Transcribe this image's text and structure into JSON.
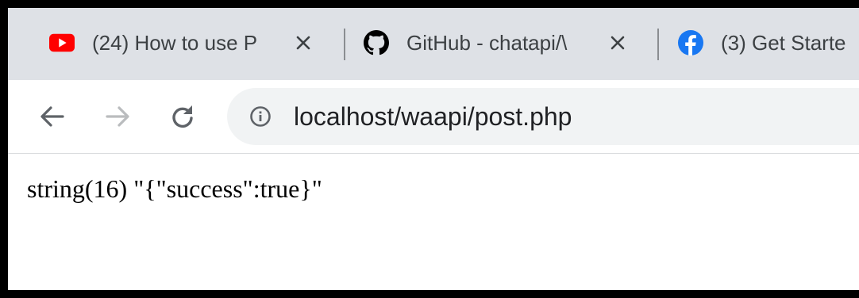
{
  "tabs": [
    {
      "title": "(24) How to use P",
      "favicon": "youtube-icon",
      "color": "#ff0000"
    },
    {
      "title": "GitHub - chatapi/\\",
      "favicon": "github-icon",
      "color": "#000000"
    },
    {
      "title": "(3) Get Starte",
      "favicon": "facebook-icon",
      "color": "#1877f2"
    }
  ],
  "toolbar": {
    "back": "back-arrow-icon",
    "forward": "forward-arrow-icon",
    "reload": "reload-icon"
  },
  "address_bar": {
    "url": "localhost/waapi/post.php",
    "security_icon": "info-icon"
  },
  "page": {
    "output": "string(16) \"{\"success\":true}\""
  }
}
